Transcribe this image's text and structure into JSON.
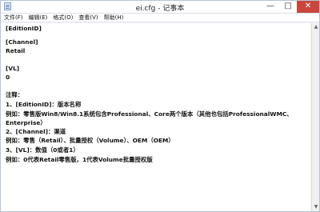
{
  "window": {
    "title": "ei.cfg - 记事本",
    "minimize_label": "—",
    "maximize_label": "□",
    "close_label": "✕"
  },
  "menu": [
    "文件(F)",
    "编辑(E)",
    "格式(O)",
    "查看(V)",
    "帮助(H)"
  ],
  "editor": {
    "lines": [
      "[EditionID]",
      "",
      "[Channel]",
      "Retail",
      "",
      "[VL]",
      "0",
      "",
      "注释：",
      "1、[EditionID]：版本名称",
      "例如：零售版Win8/Win8.1系统包含Professional、Core两个版本（其他也包括ProfessionalWMC、",
      "Enterprise）",
      "2、[Channel]：渠道",
      "例如：零售（Retail）、批量授权（Volume）、OEM（OEM）",
      "3、[VL]：数值（0或者1）",
      "例如：0代表Retail零售版，1代表Volume批量授权版"
    ]
  },
  "icons": {
    "app": "notepad-icon",
    "scroll_up": "scroll-up-arrow-icon",
    "scroll_down": "scroll-down-arrow-icon"
  }
}
